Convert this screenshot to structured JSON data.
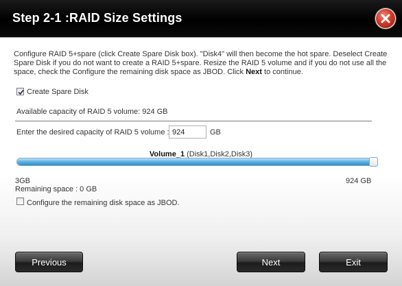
{
  "window": {
    "title": "Step 2-1 :RAID Size Settings"
  },
  "description": {
    "part1": "Configure RAID 5+spare (click Create Spare Disk box). \"Disk4\" will then become the hot spare. Deselect Create Spare Disk if you do not want to create a RAID 5+spare. Resize the RAID 5 volume and if you do not use all the space, check the Configure the remaining disk space as JBOD. Click ",
    "bold": "Next",
    "part2": " to continue."
  },
  "spare_disk": {
    "label": "Create Spare Disk",
    "checked": true
  },
  "available_capacity": "Available capacity of RAID 5 volume: 924 GB",
  "capacity_input": {
    "label": "Enter the desired capacity of RAID 5 volume :",
    "value": "924",
    "unit": "GB"
  },
  "volume": {
    "name": "Volume_1",
    "disks": " (Disk1,Disk2,Disk3)"
  },
  "slider": {
    "min_label": "3GB",
    "max_label": "924 GB",
    "min": 3,
    "max": 924,
    "value": 924,
    "fill_color": "#3a9ad6"
  },
  "remaining_space": "Remaining space : 0 GB",
  "jbod": {
    "label": "Configure the remaining disk space as JBOD.",
    "checked": false
  },
  "buttons": {
    "previous": "Previous",
    "next": "Next",
    "exit": "Exit"
  },
  "icons": {
    "close": "close-icon",
    "check": "checkmark-icon"
  }
}
